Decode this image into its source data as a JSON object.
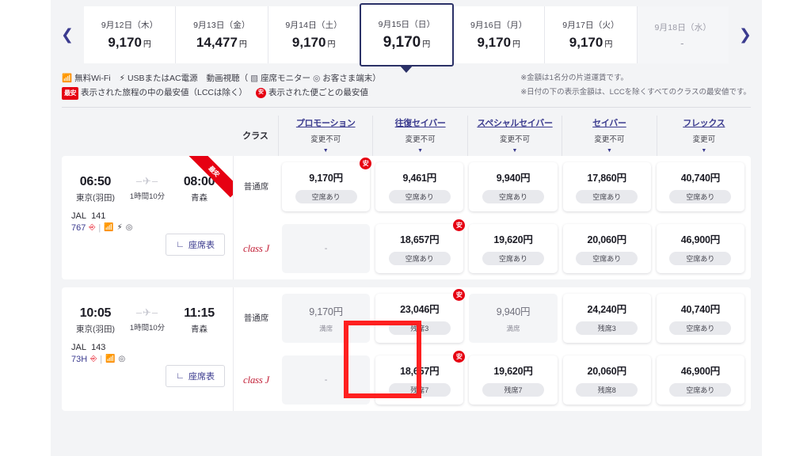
{
  "nav": {
    "prev_icon": "chevron-left-icon",
    "next_icon": "chevron-right-icon"
  },
  "dates": [
    {
      "date": "9月12日（木）",
      "price": "9,170",
      "unit": "円",
      "selected": false,
      "unavailable": false
    },
    {
      "date": "9月13日（金）",
      "price": "14,477",
      "unit": "円",
      "selected": false,
      "unavailable": false
    },
    {
      "date": "9月14日（土）",
      "price": "9,170",
      "unit": "円",
      "selected": false,
      "unavailable": false
    },
    {
      "date": "9月15日（日）",
      "price": "9,170",
      "unit": "円",
      "selected": true,
      "unavailable": false
    },
    {
      "date": "9月16日（月）",
      "price": "9,170",
      "unit": "円",
      "selected": false,
      "unavailable": false
    },
    {
      "date": "9月17日（火）",
      "price": "9,170",
      "unit": "円",
      "selected": false,
      "unavailable": false
    },
    {
      "date": "9月18日（水）",
      "price": "-",
      "unit": "",
      "selected": false,
      "unavailable": true
    }
  ],
  "legend": {
    "wifi_label": "無料Wi-Fi",
    "power_label": "USBまたはAC電源",
    "video_label": "動画視聴（",
    "monitor_label": "座席モニター",
    "device_label": "お客さま端末）",
    "cheapest_tag": "最安",
    "cheapest_text": "表示された旅程の中の最安値（LCCは除く）",
    "flight_cheapest_badge": "安",
    "flight_cheapest_text": "表示された便ごとの最安値",
    "note1": "※金額は1名分の片道運賃です。",
    "note2": "※日付の下の表示金額は、LCCを除くすべてのクラスの最安値です。"
  },
  "table_header": {
    "class_label": "クラス",
    "fares": [
      {
        "name": "プロモーション",
        "rule": "変更不可"
      },
      {
        "name": "往復セイバー",
        "rule": "変更不可"
      },
      {
        "name": "スペシャルセイバー",
        "rule": "変更不可"
      },
      {
        "name": "セイバー",
        "rule": "変更不可"
      },
      {
        "name": "フレックス",
        "rule": "変更可"
      }
    ]
  },
  "seat_map_button": "座席表",
  "cabin_labels": {
    "economy": "普通席",
    "class_j": "class J"
  },
  "flights": [
    {
      "depart_time": "06:50",
      "depart_airport": "東京(羽田)",
      "duration": "1時間10分",
      "arrive_time": "08:00",
      "arrive_airport": "青森",
      "carrier": "JAL",
      "flight_number": "141",
      "aircraft": "767",
      "ribbon": "最安",
      "rows": [
        {
          "cabin": "普通席",
          "cells": [
            {
              "amount": "9,170円",
              "status": "空席あり",
              "state": "available",
              "badge": "安"
            },
            {
              "amount": "9,461円",
              "status": "空席あり",
              "state": "available",
              "badge": ""
            },
            {
              "amount": "9,940円",
              "status": "空席あり",
              "state": "available",
              "badge": ""
            },
            {
              "amount": "17,860円",
              "status": "空席あり",
              "state": "available",
              "badge": ""
            },
            {
              "amount": "40,740円",
              "status": "空席あり",
              "state": "available",
              "badge": ""
            }
          ]
        },
        {
          "cabin": "class J",
          "cells": [
            {
              "amount": "-",
              "status": "",
              "state": "empty",
              "badge": ""
            },
            {
              "amount": "18,657円",
              "status": "空席あり",
              "state": "available",
              "badge": "安"
            },
            {
              "amount": "19,620円",
              "status": "空席あり",
              "state": "available",
              "badge": ""
            },
            {
              "amount": "20,060円",
              "status": "空席あり",
              "state": "available",
              "badge": ""
            },
            {
              "amount": "46,900円",
              "status": "空席あり",
              "state": "available",
              "badge": ""
            }
          ]
        }
      ]
    },
    {
      "depart_time": "10:05",
      "depart_airport": "東京(羽田)",
      "duration": "1時間10分",
      "arrive_time": "11:15",
      "arrive_airport": "青森",
      "carrier": "JAL",
      "flight_number": "143",
      "aircraft": "73H",
      "ribbon": "",
      "rows": [
        {
          "cabin": "普通席",
          "cells": [
            {
              "amount": "9,170円",
              "status": "満席",
              "state": "sold",
              "badge": ""
            },
            {
              "amount": "23,046円",
              "status": "残席3",
              "state": "available",
              "badge": "安"
            },
            {
              "amount": "9,940円",
              "status": "満席",
              "state": "sold",
              "badge": ""
            },
            {
              "amount": "24,240円",
              "status": "残席3",
              "state": "available",
              "badge": ""
            },
            {
              "amount": "40,740円",
              "status": "空席あり",
              "state": "available",
              "badge": ""
            }
          ]
        },
        {
          "cabin": "class J",
          "cells": [
            {
              "amount": "-",
              "status": "",
              "state": "empty",
              "badge": ""
            },
            {
              "amount": "18,657円",
              "status": "残席7",
              "state": "available",
              "badge": "安"
            },
            {
              "amount": "19,620円",
              "status": "残席7",
              "state": "available",
              "badge": ""
            },
            {
              "amount": "20,060円",
              "status": "残席8",
              "state": "available",
              "badge": ""
            },
            {
              "amount": "46,900円",
              "status": "空席あり",
              "state": "available",
              "badge": ""
            }
          ]
        }
      ]
    }
  ],
  "colors": {
    "brand_navy": "#2b3167",
    "link_blue": "#3b3b8f",
    "jal_red": "#e60012",
    "highlight_red": "#fe2020",
    "page_bg": "#f3f4f6"
  }
}
